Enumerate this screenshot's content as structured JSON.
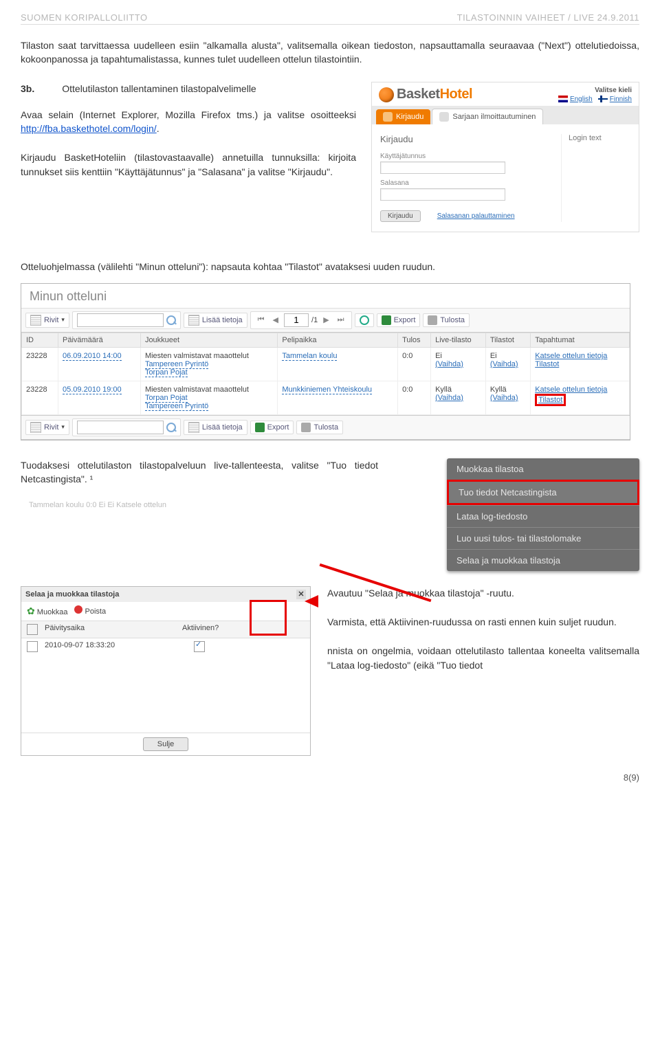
{
  "header": {
    "left": "SUOMEN KORIPALLOLIITTO",
    "right": "TILASTOINNIN VAIHEET / LIVE 24.9.2011"
  },
  "intro_para": "Tilaston saat tarvittaessa uudelleen esiin \"alkamalla alusta\", valitsemalla oikean tiedoston, napsauttamalla seuraavaa (\"Next\") ottelutiedoissa, kokoonpanossa ja tapahtumalistassa, kunnes tulet uudelleen ottelun tilastointiin.",
  "heading3b_num": "3b.",
  "heading3b_rest": "Ottelutilaston tallentaminen tilastopalvelimelle",
  "avaa_text_pre": "Avaa selain (Internet Explorer, Mozilla Firefox tms.) ja valitse osoitteeksi ",
  "avaa_link": "http://fba.baskethotel.com/login/",
  "avaa_text_post": ".",
  "kirjaudu_para": "Kirjaudu BasketHoteliin (tilastovastaavalle) annetuilla tunnuksilla: kirjoita tunnukset siis kenttiin \"Käyttäjätunnus\" ja \"Salasana\" ja valitse \"Kirjaudu\".",
  "bh": {
    "logo_a": "Basket",
    "logo_b": "Hotel",
    "lang_title": "Valitse kieli",
    "lang_en": "English",
    "lang_fi": "Finnish",
    "tab_kirjaudu": "Kirjaudu",
    "tab_sarjaan": "Sarjaan ilmoittautuminen",
    "form_title": "Kirjaudu",
    "label_user": "Käyttäjätunnus",
    "label_pass": "Salasana",
    "btn_login": "Kirjaudu",
    "link_salasana": "Salasanan palauttaminen",
    "login_text": "Login text"
  },
  "section_caption": "Otteluohjelmassa (välilehti \"Minun otteluni\"): napsauta kohtaa \"Tilastot\" avataksesi uuden ruudun.",
  "mo": {
    "title": "Minun otteluni",
    "rivit": "Rivit",
    "lisaa": "Lisää tietoja",
    "page_val": "1",
    "page_total": "/1",
    "export": "Export",
    "tulosta": "Tulosta",
    "cols": [
      "ID",
      "Päivämäärä",
      "Joukkueet",
      "Pelipaikka",
      "Tulos",
      "Live-tilasto",
      "Tilastot",
      "Tapahtumat"
    ],
    "rows": [
      {
        "id": "23228",
        "date": "06.09.2010 14:00",
        "comp": "Miesten valmistavat maaottelut",
        "teams": [
          "Tampereen Pyrintö",
          "Torpan Pojat"
        ],
        "venue": "Tammelan koulu",
        "score": "0:0",
        "live_v": "Ei",
        "live_link": "(Vaihda)",
        "stats_v": "Ei",
        "stats_link": "(Vaihda)",
        "ev1": "Katsele ottelun tietoja",
        "ev2": "Tilastot"
      },
      {
        "id": "23228",
        "date": "05.09.2010 19:00",
        "comp": "Miesten valmistavat maaottelut",
        "teams": [
          "Torpan Pojat",
          "Tampereen Pyrintö"
        ],
        "venue": "Munkkiniemen Yhteiskoulu",
        "score": "0:0",
        "live_v": "Kyllä",
        "live_link": "(Vaihda)",
        "stats_v": "Kyllä",
        "stats_link": "(Vaihda)",
        "ev1": "Katsele ottelun tietoja",
        "ev2": "Tilastot"
      }
    ]
  },
  "import_text": "Tuodaksesi ottelutilaston tilastopalveluun live-tallenteesta, valitse \"Tuo tiedot Netcastingista\". ¹",
  "ghost_row": "Tammelan koulu    0:0    Ei           Ei           Katsele ottelun",
  "context": [
    "Muokkaa tilastoa",
    "Tuo tiedot Netcastingista",
    "Lataa log-tiedosto",
    "Luo uusi tulos- tai tilastolomake",
    "Selaa ja muokkaa tilastoja"
  ],
  "browse": {
    "title": "Selaa ja muokkaa tilastoja",
    "muokkaa": "Muokkaa",
    "poista": "Poista",
    "col1": "Päivitysaika",
    "col2": "Aktiivinen?",
    "row_time": "2010-09-07 18:33:20",
    "close_btn": "Sulje"
  },
  "browse_right_1": "Avautuu \"Selaa ja muokkaa tilastoja\" -ruutu.",
  "browse_right_2": "Varmista, että Aktiivinen-ruudussa on rasti ennen kuin suljet ruudun.",
  "footnote": "nnista on ongelmia, voidaan ottelutilasto tallentaa koneelta valitsemalla \"Lataa log-tiedosto\" (eikä \"Tuo tiedot",
  "page_num": "8(9)"
}
